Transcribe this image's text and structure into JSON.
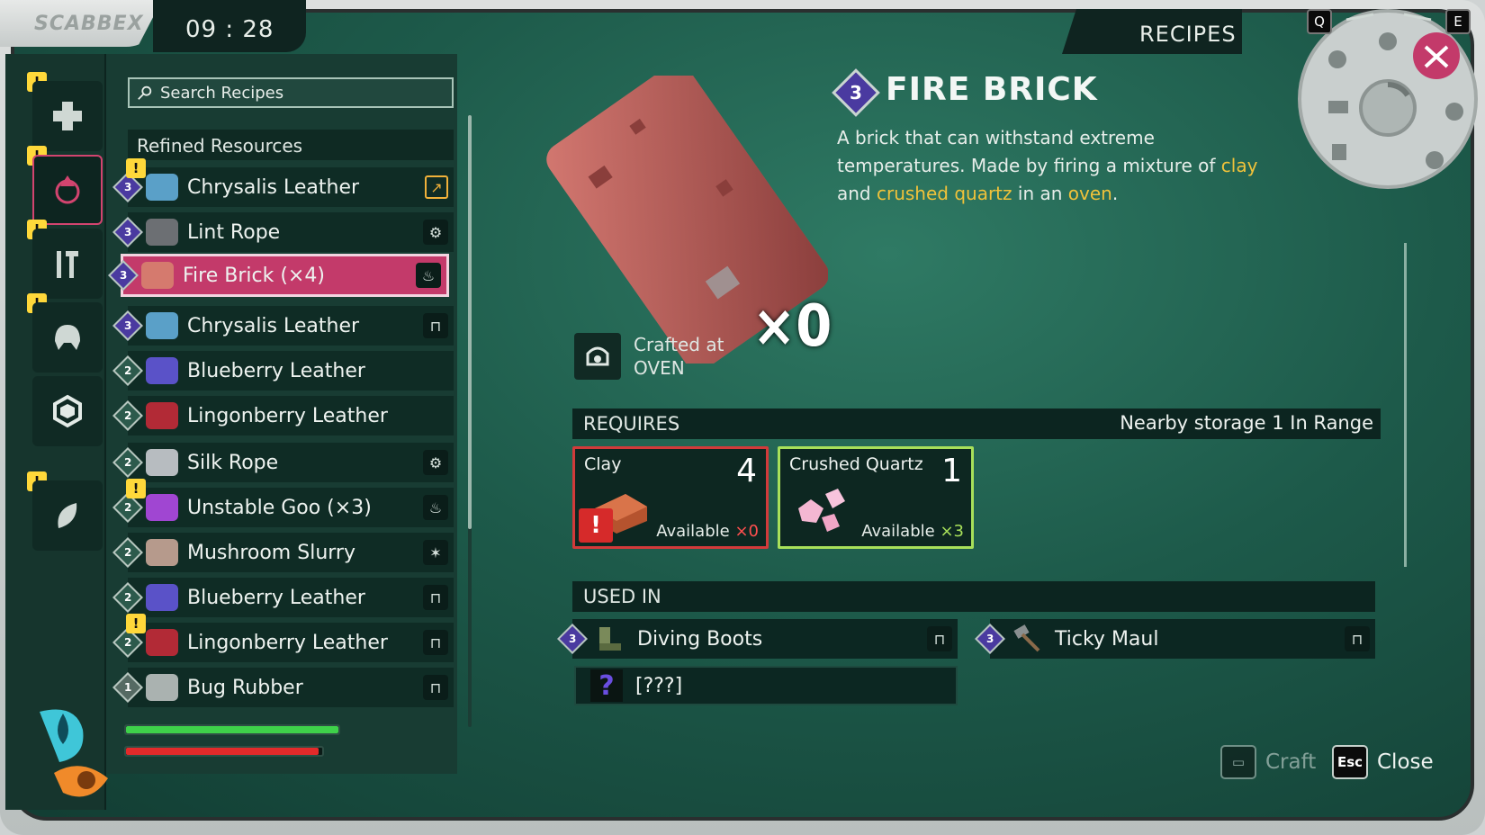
{
  "logo_text": "SCABBEX",
  "clock": "09 : 28",
  "header": {
    "title": "RECIPES",
    "key_left": "Q",
    "key_right": "E"
  },
  "search": {
    "placeholder": "Search Recipes"
  },
  "category": "Refined Resources",
  "recipes": [
    {
      "tier": "3",
      "label": "Chrysalis Leather",
      "icon_color": "#5aa0c8",
      "station": "pin-icon",
      "warn": true
    },
    {
      "tier": "3",
      "label": "Lint Rope",
      "icon_color": "#6c6f73",
      "station": "workbench-icon",
      "warn": false
    },
    {
      "tier": "3",
      "label": "Fire Brick (×4)",
      "icon_color": "#d57a6e",
      "station": "oven-icon",
      "warn": false,
      "selected": true
    },
    {
      "tier": "3",
      "label": "Chrysalis Leather",
      "icon_color": "#5aa0c8",
      "station": "rack-icon",
      "warn": false
    },
    {
      "tier": "2",
      "label": "Blueberry Leather",
      "icon_color": "#5a52c8",
      "station": "",
      "warn": false
    },
    {
      "tier": "2",
      "label": "Lingonberry Leather",
      "icon_color": "#b22a36",
      "station": "",
      "warn": false
    },
    {
      "tier": "2",
      "label": "Silk Rope",
      "icon_color": "#b7bcc0",
      "station": "workbench-icon",
      "warn": false
    },
    {
      "tier": "2",
      "label": "Unstable Goo (×3)",
      "icon_color": "#a046d2",
      "station": "oven-icon",
      "warn": true
    },
    {
      "tier": "2",
      "label": "Mushroom Slurry",
      "icon_color": "#b69a8c",
      "station": "mortar-icon",
      "warn": false
    },
    {
      "tier": "2",
      "label": "Blueberry Leather",
      "icon_color": "#5a52c8",
      "station": "rack-icon",
      "warn": false
    },
    {
      "tier": "2",
      "label": "Lingonberry Leather",
      "icon_color": "#b22a36",
      "station": "rack-icon",
      "warn": true
    },
    {
      "tier": "1",
      "label": "Bug Rubber",
      "icon_color": "#aab2b0",
      "station": "table-icon",
      "warn": false
    }
  ],
  "detail": {
    "tier": "3",
    "title": "FIRE BRICK",
    "desc_1": "A brick that can withstand extreme temperatures. Made by firing a mixture of ",
    "desc_clay": "clay",
    "desc_2": " and ",
    "desc_quartz": "crushed quartz",
    "desc_3": " in an ",
    "desc_oven": "oven",
    "desc_4": ".",
    "owned": "×0",
    "crafted_at_label": "Crafted at",
    "crafted_at_station": "OVEN"
  },
  "requires": {
    "title": "REQUIRES",
    "storage": "Nearby storage  1  In Range",
    "ingredients": [
      {
        "name": "Clay",
        "count": "4",
        "available_label": "Available",
        "available": "×0",
        "status": "missing"
      },
      {
        "name": "Crushed Quartz",
        "count": "1",
        "available_label": "Available",
        "available": "×3",
        "status": "ok"
      }
    ]
  },
  "used_in": {
    "title": "USED IN",
    "items": [
      {
        "tier": "3",
        "label": "Diving Boots"
      },
      {
        "tier": "3",
        "label": "Ticky Maul"
      },
      {
        "tier": "",
        "label": "[???]"
      }
    ]
  },
  "buttons": {
    "craft": "Craft",
    "close_key": "Esc",
    "close": "Close"
  },
  "status": {
    "stamina": 1.0,
    "health": 0.98
  },
  "colors": {
    "accent": "#c33a6a",
    "highlight": "#f0c23a",
    "missing": "#d23a3a",
    "ok": "#a8e05a"
  }
}
